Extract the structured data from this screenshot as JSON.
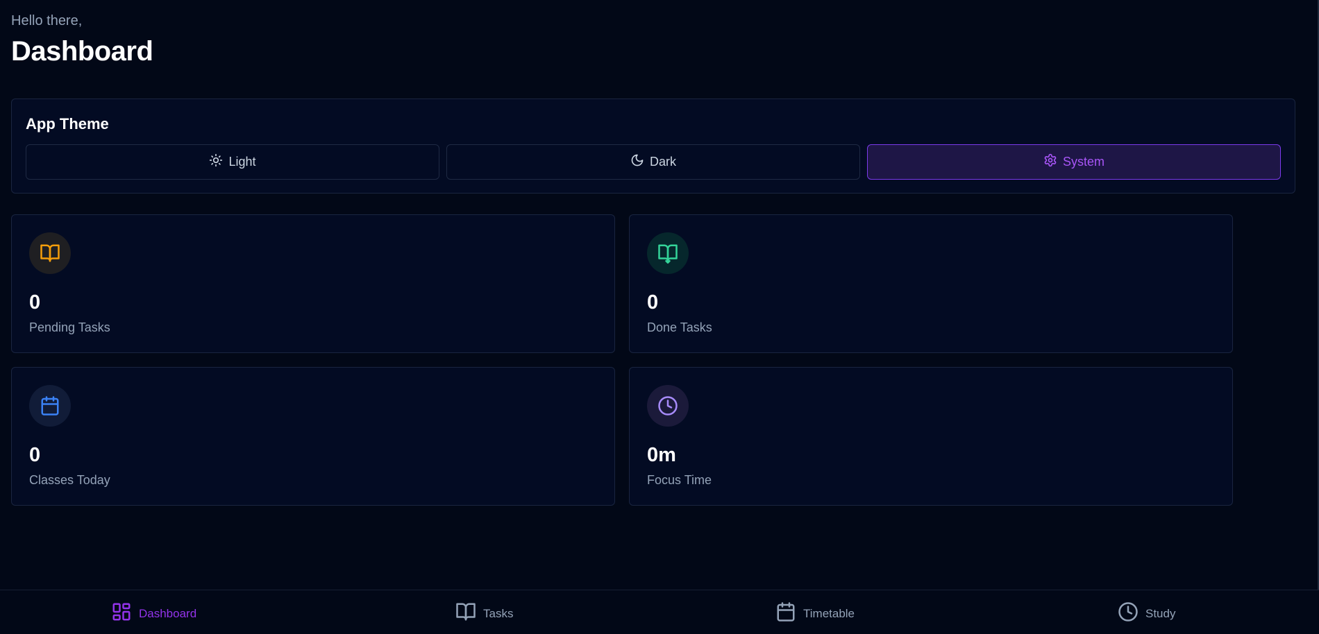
{
  "header": {
    "greeting": "Hello there,",
    "title": "Dashboard"
  },
  "theme": {
    "title": "App Theme",
    "options": [
      {
        "label": "Light",
        "icon": "sun-icon",
        "selected": false
      },
      {
        "label": "Dark",
        "icon": "moon-icon",
        "selected": false
      },
      {
        "label": "System",
        "icon": "gear-icon",
        "selected": true
      }
    ]
  },
  "stats": [
    {
      "value": "0",
      "label": "Pending Tasks",
      "icon": "book-open-icon",
      "color": "#f59e0b"
    },
    {
      "value": "0",
      "label": "Done Tasks",
      "icon": "book-open-icon",
      "color": "#34d399"
    },
    {
      "value": "0",
      "label": "Classes Today",
      "icon": "calendar-icon",
      "color": "#3b82f6"
    },
    {
      "value": "0m",
      "label": "Focus Time",
      "icon": "clock-icon",
      "color": "#a78bfa"
    }
  ],
  "nav": {
    "items": [
      {
        "label": "Dashboard",
        "icon": "dashboard-icon",
        "active": true
      },
      {
        "label": "Tasks",
        "icon": "book-open-icon",
        "active": false
      },
      {
        "label": "Timetable",
        "icon": "calendar-icon",
        "active": false
      },
      {
        "label": "Study",
        "icon": "clock-icon",
        "active": false
      }
    ]
  },
  "colors": {
    "background": "#020817",
    "card": "#030b23",
    "accent": "#9333ea"
  }
}
